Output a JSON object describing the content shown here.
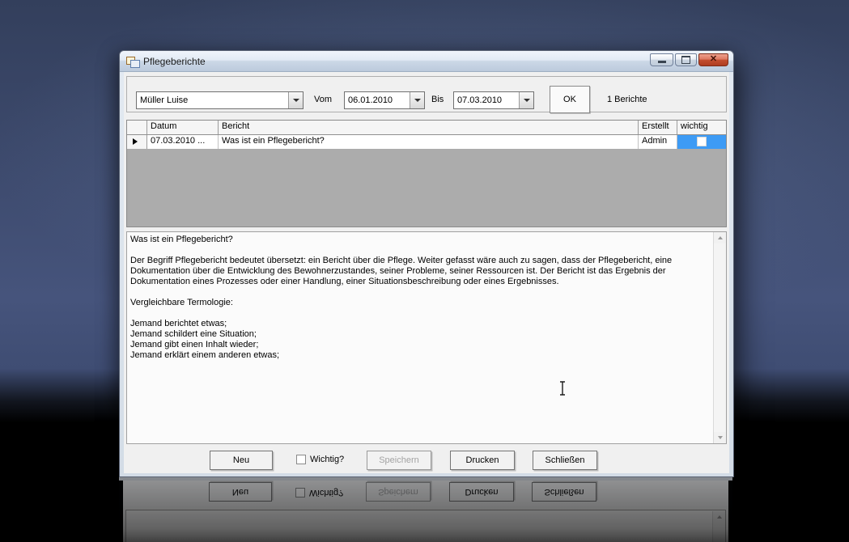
{
  "window": {
    "title": "Pflegeberichte"
  },
  "icons": {
    "close": "✕"
  },
  "toolbar": {
    "resident": "Müller Luise",
    "vom_label": "Vom",
    "from_date": "06.01.2010",
    "bis_label": "Bis",
    "to_date": "07.03.2010",
    "ok_label": "OK",
    "count_label": "1 Berichte"
  },
  "grid": {
    "columns": [
      "Datum",
      "Bericht",
      "Erstellt",
      "wichtig"
    ],
    "rows": [
      {
        "datum": "07.03.2010 ...",
        "bericht": "Was ist ein Pflegebericht?",
        "erstellt": "Admin",
        "wichtig_checked": false
      }
    ]
  },
  "report_text": "Was ist ein Pflegebericht?\n\nDer Begriff Pflegebericht bedeutet übersetzt: ein Bericht über die Pflege. Weiter gefasst wäre auch zu sagen, dass der Pflegebericht, eine Dokumentation über die Entwicklung des Bewohnerzustandes, seiner Probleme, seiner Ressourcen ist. Der Bericht ist das Ergebnis der Dokumentation eines Prozesses oder einer Handlung, einer Situationsbeschreibung oder eines Ergebnisses.\n\nVergleichbare Termologie:\n\nJemand berichtet etwas;\nJemand schildert eine Situation;\nJemand gibt einen Inhalt wieder;\nJemand erklärt einem anderen etwas;",
  "footer": {
    "neu_label": "Neu",
    "wichtig_label": "Wichtig?",
    "wichtig_checked": false,
    "speichern_label": "Speichern",
    "speichern_enabled": false,
    "drucken_label": "Drucken",
    "schliessen_label": "Schließen"
  },
  "colors": {
    "selection_blue": "#3d9bf5",
    "titlebar_top": "#f0f5fb",
    "titlebar_bottom": "#bccadc",
    "close_button_red": "#c44f30",
    "client_bg": "#f0f0f0",
    "grid_empty_bg": "#acacac",
    "backdrop_blue": "#46547c"
  }
}
